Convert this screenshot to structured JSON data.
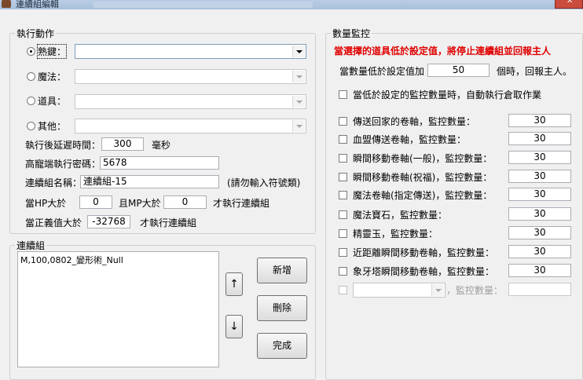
{
  "window": {
    "title": "連續組編輯",
    "close_glyph": "✕"
  },
  "action_group": {
    "legend": "執行動作",
    "rows": [
      {
        "label": "熟鍵：",
        "checked": true,
        "enabled": true
      },
      {
        "label": "魔法：",
        "checked": false,
        "enabled": false
      },
      {
        "label": "道具：",
        "checked": false,
        "enabled": false
      },
      {
        "label": "其他：",
        "checked": false,
        "enabled": false
      }
    ],
    "delay_label": "執行後延遲時間：",
    "delay_value": "300",
    "delay_unit": "毫秒",
    "password_label": "高寵端執行密碼：",
    "password_value": "5678",
    "name_label": "連續組名稱：",
    "name_value": "連續組-15",
    "name_hint": "(請勿輸入符號類)",
    "hp_label": "當HP大於",
    "hp_value": "0",
    "mp_label": "且MP大於",
    "mp_value": "0",
    "hpmp_suffix": "才執行連續組",
    "justice_label": "當正義值大於",
    "justice_value": "-32768",
    "justice_suffix": "才執行連續組"
  },
  "sequence_group": {
    "legend": "連續組",
    "items": [
      "M,100,0802_變形術_Null"
    ],
    "up_glyph": "↑",
    "down_glyph": "↓",
    "add_label": "新增",
    "delete_label": "刪除",
    "done_label": "完成"
  },
  "monitor_group": {
    "legend": "數量監控",
    "warning": "當選擇的道具低於設定值，將停止連續組並回報主人",
    "threshold_prefix": "當數量低於設定值加",
    "threshold_value": "50",
    "threshold_suffix": "個時，回報主人。",
    "auto_label": "當低於設定的監控數量時，自動執行倉取作業",
    "items": [
      {
        "label": "傳送回家的卷軸，監控數量：",
        "value": "30"
      },
      {
        "label": "血盟傳送卷軸，監控數量：",
        "value": "30"
      },
      {
        "label": "瞬間移動卷軸(一般)，監控數量：",
        "value": "30"
      },
      {
        "label": "瞬間移動卷軸(祝福)，監控數量：",
        "value": "30"
      },
      {
        "label": "魔法卷軸(指定傳送)，監控數量：",
        "value": "30"
      },
      {
        "label": "魔法寶石，監控數量：",
        "value": "30"
      },
      {
        "label": "精靈玉，監控數量：",
        "value": "30"
      },
      {
        "label": "近距離瞬間移動卷軸，監控數量：",
        "value": "30"
      },
      {
        "label": "象牙塔瞬間移動卷軸，監控數量：",
        "value": "30"
      }
    ],
    "custom_label": "，監控數量："
  }
}
